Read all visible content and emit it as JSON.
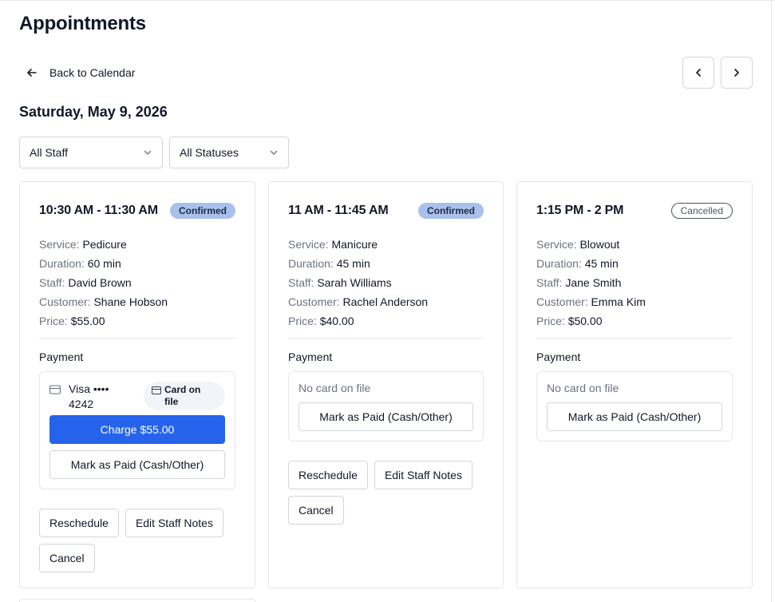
{
  "page": {
    "title": "Appointments"
  },
  "nav": {
    "back_label": "Back to Calendar",
    "back_icon": "arrow-left-icon",
    "prev_icon": "chevron-left-icon",
    "next_icon": "chevron-right-icon"
  },
  "date": "Saturday, May 9, 2026",
  "filters": {
    "staff": "All Staff",
    "status": "All Statuses"
  },
  "labels": {
    "service": "Service:",
    "duration": "Duration:",
    "staff": "Staff:",
    "customer": "Customer:",
    "price": "Price:",
    "payment": "Payment",
    "mark_paid": "Mark as Paid (Cash/Other)",
    "no_card": "No card on file",
    "reschedule": "Reschedule",
    "edit_notes": "Edit Staff Notes",
    "cancel": "Cancel"
  },
  "appointments": [
    {
      "time": "10:30 AM - 11:30 AM",
      "status": "Confirmed",
      "service": "Pedicure",
      "duration": "60 min",
      "staff": "David Brown",
      "customer": "Shane Hobson",
      "price": "$55.00",
      "card_line1": "Visa ••••",
      "card_line2": "4242",
      "card_badge_line1": "Card on",
      "card_badge_line2": "file",
      "charge_label": "Charge $55.00"
    },
    {
      "time": "11 AM - 11:45 AM",
      "status": "Confirmed",
      "service": "Manicure",
      "duration": "45 min",
      "staff": "Sarah Williams",
      "customer": "Rachel Anderson",
      "price": "$40.00"
    },
    {
      "time": "1:15 PM - 2 PM",
      "status": "Cancelled",
      "service": "Blowout",
      "duration": "45 min",
      "staff": "Jane Smith",
      "customer": "Emma Kim",
      "price": "$50.00"
    }
  ],
  "colors": {
    "primary": "#2563eb",
    "confirmed_badge": "#a9c0ec",
    "border": "#e5e7eb"
  }
}
